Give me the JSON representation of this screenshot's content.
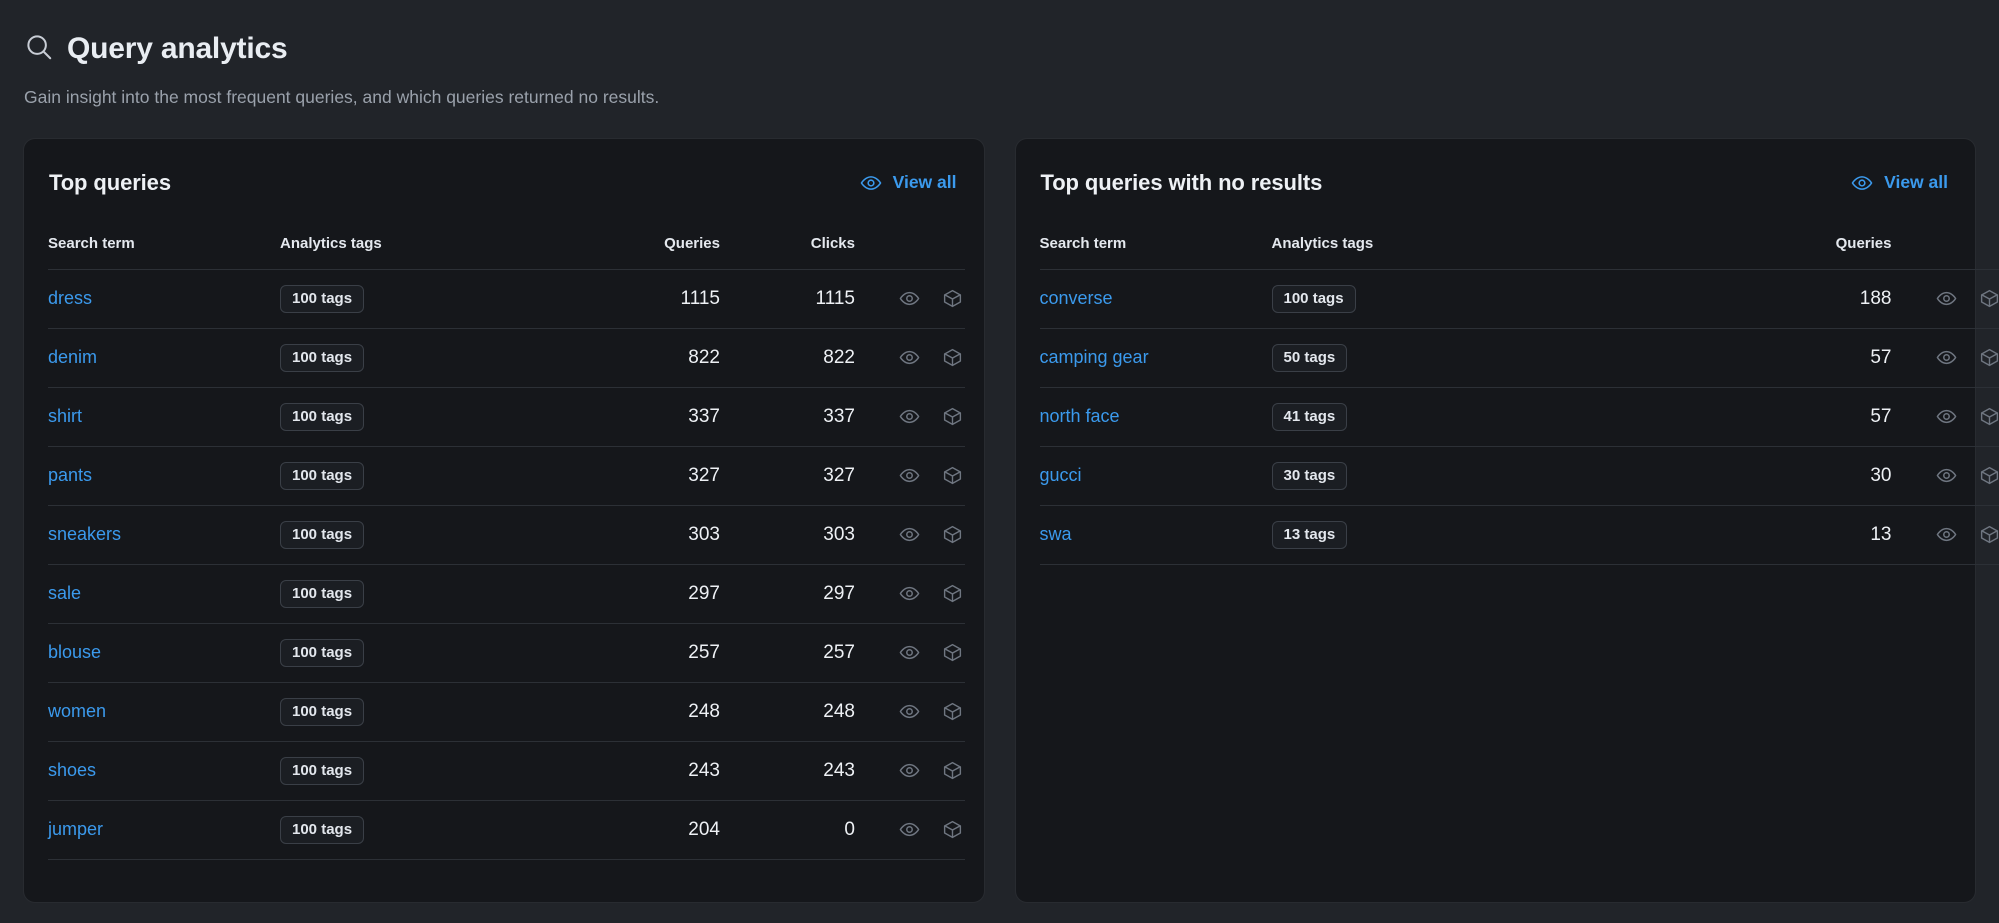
{
  "header": {
    "icon": "search-icon",
    "title": "Query analytics",
    "subtitle": "Gain insight into the most frequent queries, and which queries returned no results."
  },
  "colors": {
    "page_background": "#212429",
    "card_background": "#15171b",
    "link_blue": "#3b9aed",
    "text_primary": "#e9edf2",
    "text_muted": "#9aa1ab",
    "divider": "#2c3036",
    "icon_muted": "#6f7681"
  },
  "cards": [
    {
      "id": "top-queries",
      "title": "Top queries",
      "view_all": {
        "label": "View all",
        "icon": "eye-icon"
      },
      "columns": [
        "Search term",
        "Analytics tags",
        "Queries",
        "Clicks"
      ],
      "row_actions": [
        "eye-icon",
        "package-icon"
      ],
      "rows": [
        {
          "term": "dress",
          "tags": "100 tags",
          "queries": "1115",
          "clicks": "1115"
        },
        {
          "term": "denim",
          "tags": "100 tags",
          "queries": "822",
          "clicks": "822"
        },
        {
          "term": "shirt",
          "tags": "100 tags",
          "queries": "337",
          "clicks": "337"
        },
        {
          "term": "pants",
          "tags": "100 tags",
          "queries": "327",
          "clicks": "327"
        },
        {
          "term": "sneakers",
          "tags": "100 tags",
          "queries": "303",
          "clicks": "303"
        },
        {
          "term": "sale",
          "tags": "100 tags",
          "queries": "297",
          "clicks": "297"
        },
        {
          "term": "blouse",
          "tags": "100 tags",
          "queries": "257",
          "clicks": "257"
        },
        {
          "term": "women",
          "tags": "100 tags",
          "queries": "248",
          "clicks": "248"
        },
        {
          "term": "shoes",
          "tags": "100 tags",
          "queries": "243",
          "clicks": "243"
        },
        {
          "term": "jumper",
          "tags": "100 tags",
          "queries": "204",
          "clicks": "0"
        }
      ]
    },
    {
      "id": "top-queries-no-results",
      "title": "Top queries with no results",
      "view_all": {
        "label": "View all",
        "icon": "eye-icon"
      },
      "columns": [
        "Search term",
        "Analytics tags",
        "Queries"
      ],
      "row_actions": [
        "eye-icon",
        "package-icon"
      ],
      "rows": [
        {
          "term": "converse",
          "tags": "100 tags",
          "queries": "188"
        },
        {
          "term": "camping gear",
          "tags": "50 tags",
          "queries": "57"
        },
        {
          "term": "north face",
          "tags": "41 tags",
          "queries": "57"
        },
        {
          "term": "gucci",
          "tags": "30 tags",
          "queries": "30"
        },
        {
          "term": "swa",
          "tags": "13 tags",
          "queries": "13"
        }
      ]
    }
  ]
}
